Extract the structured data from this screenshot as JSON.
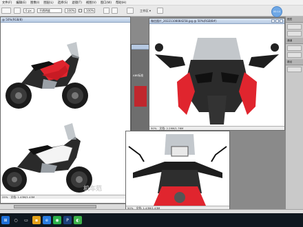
{
  "app": {
    "menus": [
      "文件(F)",
      "编辑(E)",
      "图像(I)",
      "图层(L)",
      "选择(S)",
      "滤镜(T)",
      "视图(V)",
      "窗口(W)",
      "帮助(H)"
    ]
  },
  "options_bar": {
    "feather_value": "0 px",
    "style_value": "不透明度",
    "opacity_label": "100%",
    "flow_label": "100%",
    "workspace_label": "工作区 ▾"
  },
  "camera_bubble": {
    "label": "00:14"
  },
  "windows": {
    "left": {
      "title": "@ 50%(RGB/8)",
      "zoom": "25%",
      "status": "文档: 1.43M/1.43M"
    },
    "main": {
      "title": "微信图片_20221108084258.jpg @ 50%(RGB/8#)",
      "tooltip": "C:\\Users\\xx\\Desktop\\三轮车照片\\微信图片_20221108084258.jpg",
      "zoom": "50%",
      "status": "文档: 2.29M/1.76M"
    },
    "bottom": {
      "zoom": "50%",
      "status": "文档: 1.43M/1.43M"
    },
    "side_strip_text": "ABS标准"
  },
  "watermark": "机车范",
  "right_panel": {
    "tabs": [
      "图层",
      "通道",
      "路径"
    ]
  },
  "taskbar": {
    "icons": [
      "start-icon",
      "search-icon",
      "taskview-icon",
      "explorer-icon",
      "browser-icon",
      "wechat-icon",
      "photoshop-icon",
      "chat-icon"
    ]
  },
  "colors": {
    "accent": "#e0252e",
    "title_bar": "#b6c9e2",
    "taskbar": "#101820"
  }
}
